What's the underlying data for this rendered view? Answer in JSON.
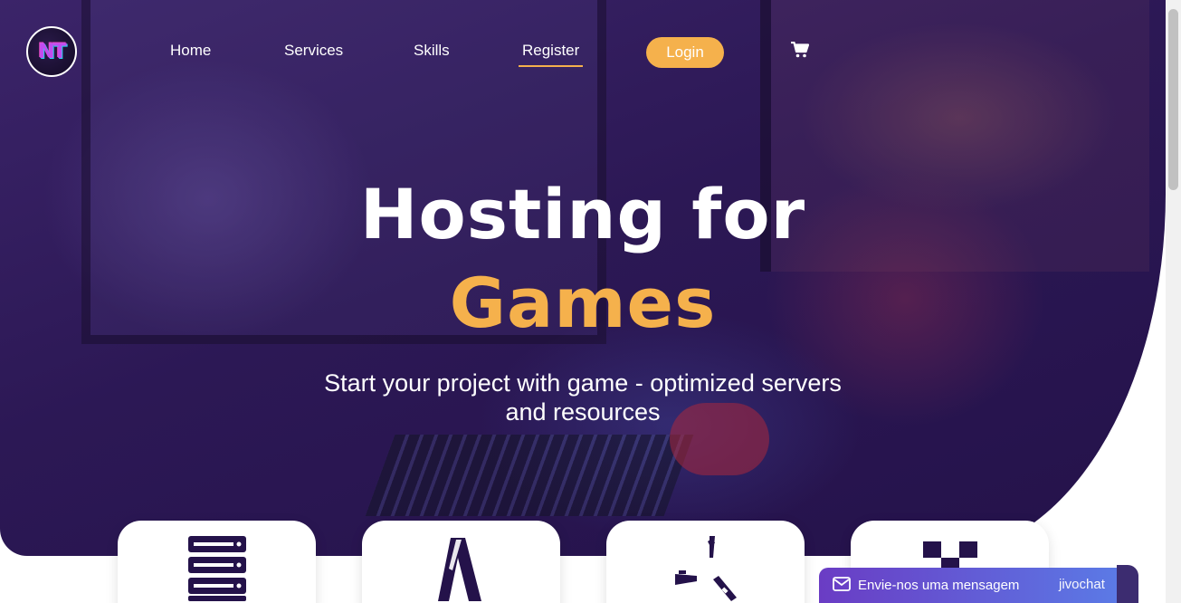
{
  "brand": {
    "logo_text": "NT",
    "logo_name": "logo"
  },
  "nav": {
    "items": [
      {
        "label": "Home"
      },
      {
        "label": "Services"
      },
      {
        "label": "Skills"
      },
      {
        "label": "Register"
      }
    ],
    "active": "Register",
    "login_label": "Login",
    "cart_icon": "shopping-cart-icon"
  },
  "hero": {
    "headline_line1": "Hosting for",
    "headline_line2": "Games",
    "subtitle": "Start your project with game - optimized servers and resources"
  },
  "cards": [
    {
      "icon": "server-rack-icon"
    },
    {
      "icon": "game-logo-a-icon"
    },
    {
      "icon": "rust-game-icon"
    },
    {
      "icon": "checkered-block-icon"
    }
  ],
  "chat": {
    "message": "Envie-nos uma mensagem",
    "brand": "jivochat",
    "icon": "envelope-icon"
  },
  "colors": {
    "accent": "#f5b14c",
    "hero_bg": "#2c1855",
    "card_icon": "#24124a",
    "chat_start": "#6a3cc4",
    "chat_end": "#5a7ee8"
  }
}
